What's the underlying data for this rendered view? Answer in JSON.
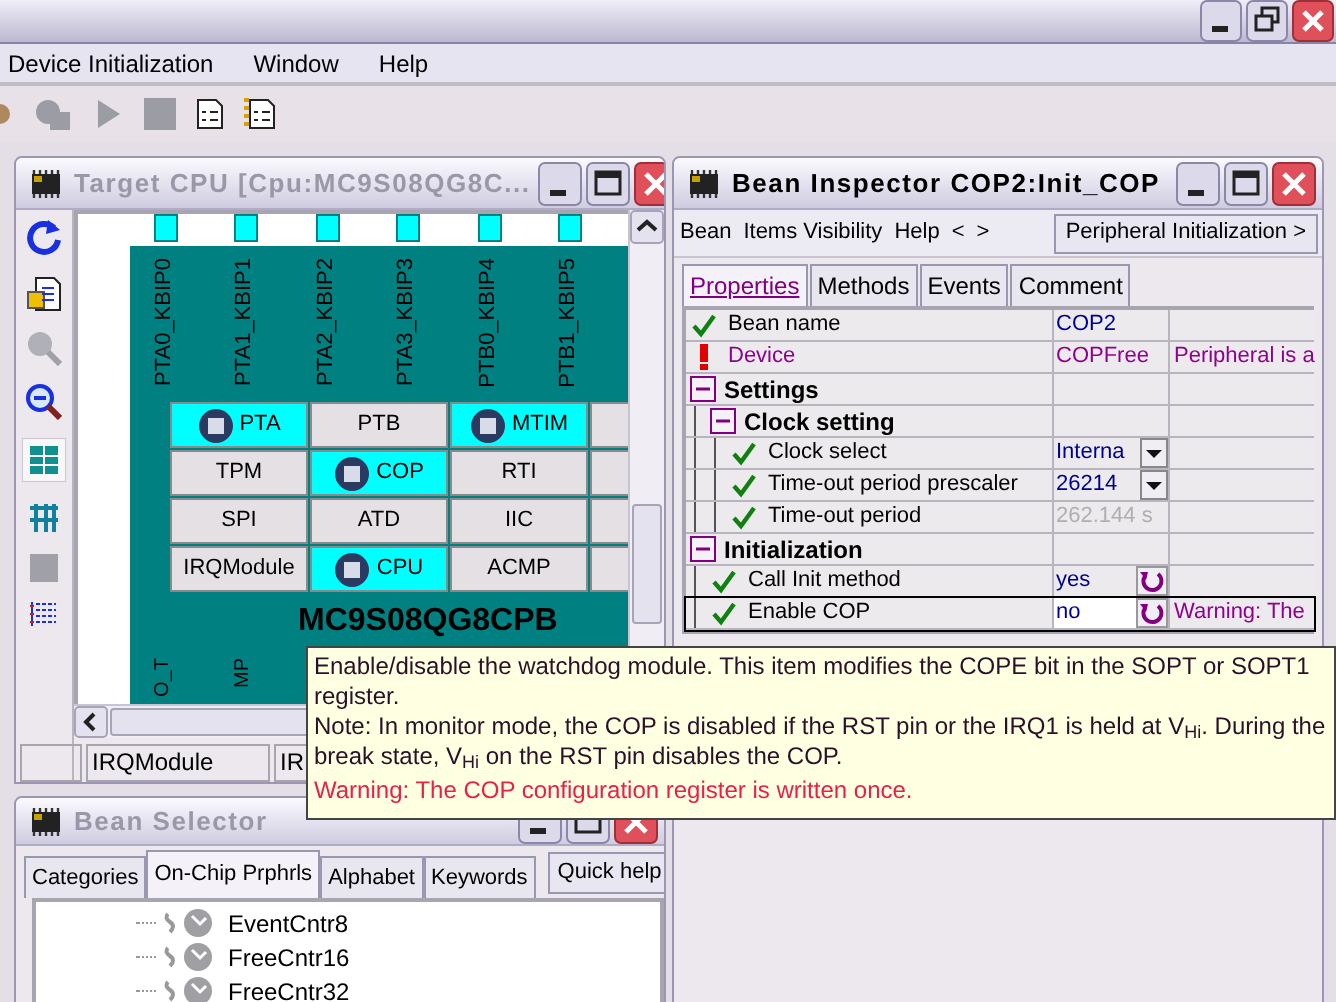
{
  "menu": [
    "Device Initialization",
    "Window",
    "Help"
  ],
  "target_cpu": {
    "title": "Target CPU [Cpu:MC9S08QG8C...",
    "active": false,
    "pins_top": [
      "PTA0_KBIP0",
      "PTA1_KBIP1",
      "PTA2_KBIP2",
      "PTA3_KBIP3",
      "PTB0_KBIP4",
      "PTB1_KBIP5"
    ],
    "modules": [
      {
        "label": "PTA",
        "used": true
      },
      {
        "label": "PTB",
        "used": false
      },
      {
        "label": "MTIM",
        "used": true
      },
      {
        "label": "TPM",
        "used": false
      },
      {
        "label": "COP",
        "used": true
      },
      {
        "label": "RTI",
        "used": false
      },
      {
        "label": "SPI",
        "used": false
      },
      {
        "label": "ATD",
        "used": false
      },
      {
        "label": "IIC",
        "used": false
      },
      {
        "label": "IRQModule",
        "used": false
      },
      {
        "label": "CPU",
        "used": true
      },
      {
        "label": "ACMP",
        "used": false
      }
    ],
    "chip_name": "MC9S08QG8CPB",
    "pins_bottom": [
      "O_T",
      "MP"
    ],
    "status_cells": [
      "IRQModule",
      "IR"
    ]
  },
  "bean_inspector": {
    "title": "Bean Inspector COP2:Init_COP",
    "active": true,
    "menu": [
      "Bean",
      "Items Visibility",
      "Help",
      "<",
      ">"
    ],
    "mode_button": "Peripheral Initialization >",
    "tabs": [
      {
        "label": "Properties",
        "selected": true
      },
      {
        "label": "Methods",
        "selected": false
      },
      {
        "label": "Events",
        "selected": false
      },
      {
        "label": "Comment",
        "selected": false
      }
    ],
    "properties": [
      {
        "kind": "text",
        "name": "Bean name",
        "ok": true,
        "value": "COP2",
        "disabled": false,
        "selected": false
      },
      {
        "kind": "text",
        "name": "Device",
        "ok": false,
        "value": "COPFree",
        "hint": "Peripheral is a",
        "disabled": false,
        "selected": false
      },
      {
        "kind": "group",
        "name": "Settings",
        "expanded": true,
        "children": [
          {
            "kind": "group",
            "name": "Clock setting",
            "expanded": true,
            "children": [
              {
                "kind": "dropdown",
                "name": "Clock select",
                "ok": true,
                "value": "Interna",
                "disabled": false,
                "selected": false
              },
              {
                "kind": "dropdown",
                "name": "Time-out period prescaler",
                "ok": true,
                "value": "26214",
                "disabled": false,
                "selected": false
              },
              {
                "kind": "text",
                "name": "Time-out period",
                "ok": true,
                "value": "262.144 s",
                "disabled": true,
                "selected": false
              }
            ]
          }
        ]
      },
      {
        "kind": "group",
        "name": "Initialization",
        "expanded": true,
        "children": [
          {
            "kind": "toggle",
            "name": "Call Init method",
            "ok": true,
            "value": "yes",
            "disabled": false,
            "selected": false
          },
          {
            "kind": "toggle",
            "name": "Enable COP",
            "ok": true,
            "value": "no",
            "hint": "Warning: The",
            "disabled": false,
            "selected": true
          }
        ]
      }
    ]
  },
  "tooltip": {
    "lines": [
      "Enable/disable the watchdog module. This item modifies the COPE bit in the SOPT or SOPT1 register.",
      "Note: In monitor mode, the COP is disabled if the RST pin or the IRQ1 is held at V$_{Hi}$. During the break state, V$_{Hi}$ on the RST pin disables the COP."
    ],
    "warning": "Warning: The COP configuration register is written once."
  },
  "bean_selector": {
    "title": "Bean Selector",
    "active": false,
    "tabs": [
      {
        "label": "Categories",
        "selected": false
      },
      {
        "label": "On-Chip Prphrls",
        "selected": true
      },
      {
        "label": "Alphabet",
        "selected": false
      },
      {
        "label": "Keywords",
        "selected": false
      }
    ],
    "help_button": "Quick help",
    "items": [
      "EventCntr8",
      "FreeCntr16",
      "FreeCntr32"
    ]
  }
}
